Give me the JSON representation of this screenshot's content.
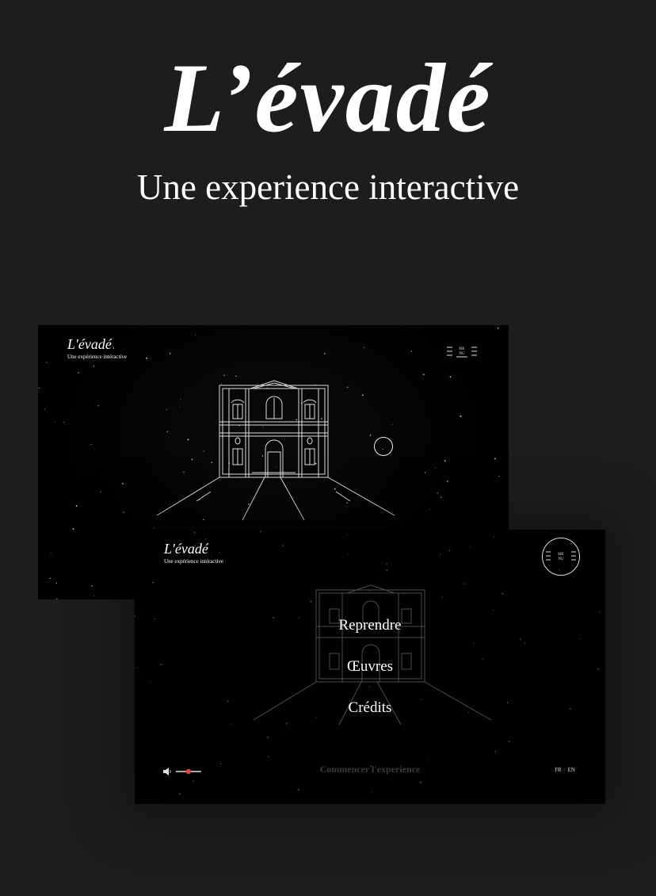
{
  "hero": {
    "title": "L’évadé",
    "subtitle": "Une experience interactive"
  },
  "screen_back": {
    "brand_title": "L'évadé",
    "brand_subtitle": "Une expérience intéractive",
    "menu_label": "ME NU",
    "menu_icon": "menu-lines-icon"
  },
  "screen_front": {
    "brand_title": "L'évadé",
    "brand_subtitle": "Une expérience intéractive",
    "menu_label": "ME NU",
    "menu_items": [
      "Reprendre",
      "Œuvres",
      "Crédits"
    ],
    "start_label": "Commencer l'experience",
    "volume_icon": "speaker-icon",
    "volume_level": 0.5,
    "lang_fr": "FR",
    "lang_en": "EN",
    "accent_color": "#e0443c"
  },
  "colors": {
    "background": "#1d1d1d",
    "screen": "#000000",
    "text": "#ffffff"
  }
}
